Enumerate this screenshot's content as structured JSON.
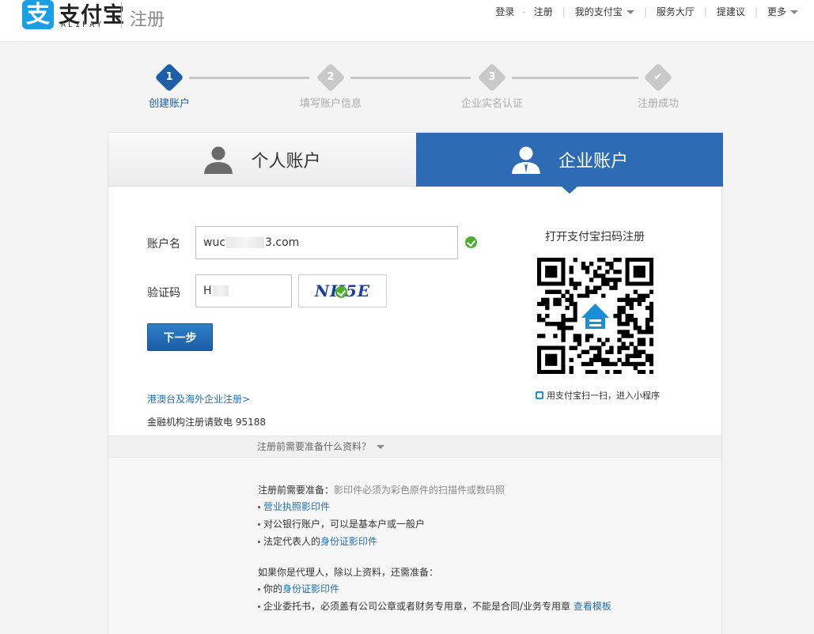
{
  "header": {
    "logo_glyph": "支",
    "logo_text": "支付宝",
    "logo_sub": "ALIPAY",
    "page_title": "注册"
  },
  "topnav": {
    "login": "登录",
    "register": "注册",
    "my_alipay": "我的支付宝",
    "service_hall": "服务大厅",
    "feedback": "提建议",
    "more": "更多"
  },
  "steps": [
    {
      "num": "1",
      "label": "创建账户",
      "active": true
    },
    {
      "num": "2",
      "label": "填写账户信息",
      "active": false
    },
    {
      "num": "3",
      "label": "企业实名认证",
      "active": false
    },
    {
      "num": "✔",
      "label": "注册成功",
      "active": false
    }
  ],
  "tabs": {
    "personal": "个人账户",
    "company": "企业账户"
  },
  "form": {
    "account_label": "账户名",
    "account_value_start": "wuc",
    "account_value_end": "3.com",
    "captcha_label": "验证码",
    "captcha_value": "H",
    "captcha_image_text": "NH5E",
    "next_button": "下一步"
  },
  "links": {
    "overseas": "港澳台及海外企业注册>",
    "finance_note": "金融机构注册请致电 95188"
  },
  "qr": {
    "title": "打开支付宝扫码注册",
    "hint": "用支付宝扫一扫，进入小程序"
  },
  "prep": {
    "toggle": "注册前需要准备什么资料？",
    "heading": "注册前需要准备：",
    "heading_note": "影印件必须为彩色原件的扫描件或数码照",
    "item1_link": "营业执照影印件",
    "item2": "对公银行账户，可以是基本户或一般户",
    "item3_prefix": "法定代表人的",
    "item3_link": "身份证影印件",
    "agent_heading": "如果你是代理人，除以上资料，还需准备：",
    "agent_item1_prefix": "你的",
    "agent_item1_link": "身份证影印件",
    "agent_item2": "企业委托书，必须盖有公司公章或者财务专用章，不能是合同/业务专用章",
    "agent_item2_link": "查看模板"
  },
  "colors": {
    "brand_blue": "#1c5fa8",
    "tab_active": "#2e6bb5",
    "link": "#1f6fb2",
    "success": "#4caf2d"
  }
}
